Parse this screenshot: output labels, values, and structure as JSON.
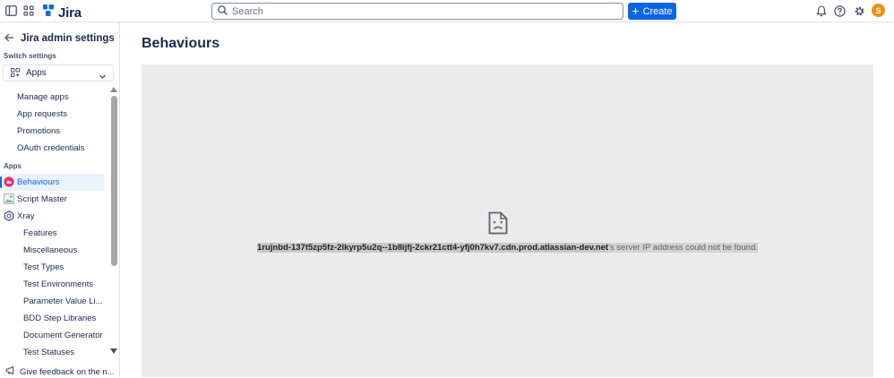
{
  "topbar": {
    "app_name": "Jira",
    "search_placeholder": "Search",
    "create_label": "Create",
    "avatar_initial": "S",
    "brand_color": "#0c66e4",
    "avatar_color": "#f18d13",
    "icons": [
      "sidebar-toggle-icon",
      "app-switcher-icon",
      "jira-logo-icon",
      "search-icon",
      "bell-icon",
      "help-icon",
      "gear-icon"
    ]
  },
  "sidebar": {
    "title": "Jira admin settings",
    "switch_label": "Switch settings",
    "switch_value": "Apps",
    "items": [
      {
        "label": "Manage apps"
      },
      {
        "label": "App requests"
      },
      {
        "label": "Promotions"
      },
      {
        "label": "OAuth credentials"
      }
    ],
    "section_label": "Apps",
    "apps": [
      {
        "label": "Behaviours",
        "active": true
      },
      {
        "label": "Script Master"
      },
      {
        "label": "Xray"
      }
    ],
    "xray_items": [
      {
        "label": "Features"
      },
      {
        "label": "Miscellaneous"
      },
      {
        "label": "Test Types"
      },
      {
        "label": "Test Environments"
      },
      {
        "label": "Parameter Value Li..."
      },
      {
        "label": "BDD Step Libraries"
      },
      {
        "label": "Document Generator"
      },
      {
        "label": "Test Statuses"
      }
    ],
    "feedback_label": "Give feedback on the n..."
  },
  "main": {
    "page_title": "Behaviours",
    "error": {
      "host": "1rujnbd-137t5zp5fz-2lkyrp5u2q--1b8ijfj-2ckr21ctt4-yfj0h7kv7.cdn.prod.atlassian-dev.net",
      "message": "'s server IP address could not be found."
    }
  }
}
